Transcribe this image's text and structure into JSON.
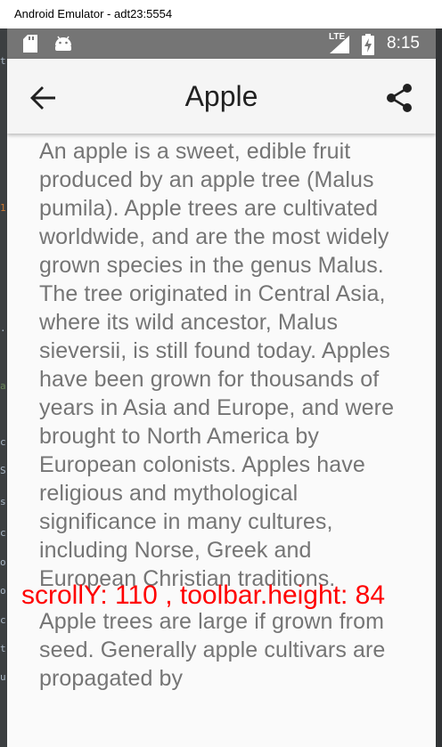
{
  "window": {
    "title": "Android Emulator - adt23:5554"
  },
  "ide_strip_glyphs": [
    "t",
    "1",
    ".",
    "a",
    "c",
    "S",
    "s",
    "c",
    "o",
    "o",
    "c",
    "t",
    "u"
  ],
  "status_bar": {
    "time": "8:15",
    "network": "LTE",
    "icons": [
      "sd-card-icon",
      "android-icon",
      "signal-icon",
      "battery-charging-icon"
    ]
  },
  "toolbar": {
    "title": "Apple",
    "back_icon": "arrow-back-icon",
    "share_icon": "share-icon"
  },
  "article": {
    "paragraphs": [
      "An apple is a sweet, edible fruit produced by an apple tree (Malus pumila). Apple trees are cultivated worldwide, and are the most widely grown species in the genus Malus. The tree originated in Central Asia, where its wild ancestor, Malus sieversii, is still found today. Apples have been grown for thousands of years in Asia and Europe, and were brought to North America by European colonists. Apples have religious and mythological significance in many cultures, including Norse, Greek and European Christian traditions.",
      "Apple trees are large if grown from seed. Generally apple cultivars are propagated by"
    ]
  },
  "debug_overlay": {
    "text": "scrollY: 110 , toolbar.height: 84"
  },
  "colors": {
    "status_bar": "#757575",
    "toolbar": "#f5f5f5",
    "body_text": "#757575",
    "debug_text": "#ff0000"
  }
}
